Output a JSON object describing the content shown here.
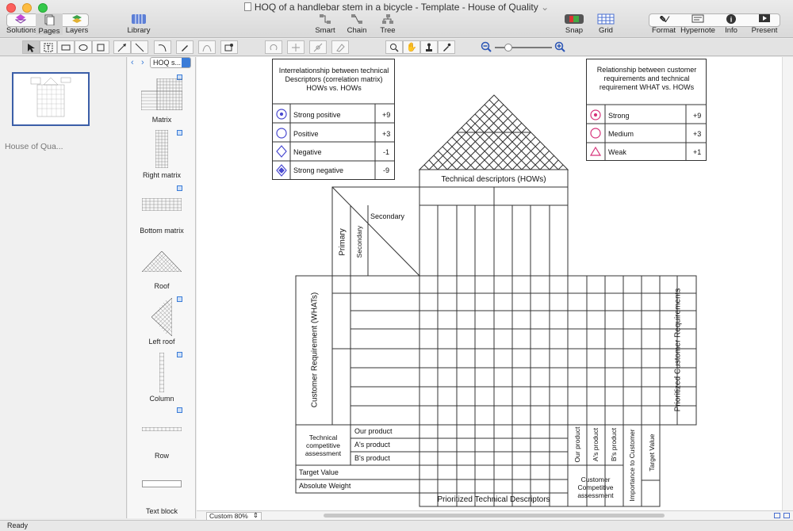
{
  "window": {
    "title": "HOQ of a handlebar stem in a bicycle - Template - House of Quality"
  },
  "toolbar": {
    "solutions": "Solutions",
    "pages": "Pages",
    "layers": "Layers",
    "library": "Library",
    "smart": "Smart",
    "chain": "Chain",
    "tree": "Tree",
    "snap": "Snap",
    "grid": "Grid",
    "format": "Format",
    "hypernote": "Hypernote",
    "info": "Info",
    "present": "Present"
  },
  "pages_panel": {
    "thumb_label": "House of Qua..."
  },
  "library": {
    "selector": "HOQ s...",
    "items": [
      "Matrix",
      "Right matrix",
      "Bottom matrix",
      "Roof",
      "Left roof",
      "Column",
      "Row",
      "Text block"
    ]
  },
  "legend_left": {
    "title": "Interrelationship between technical Descriptors (correlation matrix) HOWs vs. HOWs",
    "rows": [
      {
        "label": "Strong positive",
        "value": "+9"
      },
      {
        "label": "Positive",
        "value": "+3"
      },
      {
        "label": "Negative",
        "value": "-1"
      },
      {
        "label": "Strong negative",
        "value": "-9"
      }
    ]
  },
  "legend_right": {
    "title": "Relationship between customer requirements and technical requirement WHAT vs. HOWs",
    "rows": [
      {
        "label": "Strong",
        "value": "+9"
      },
      {
        "label": "Medium",
        "value": "+3"
      },
      {
        "label": "Weak",
        "value": "+1"
      }
    ]
  },
  "hoq": {
    "technical_descriptors": "Technical descriptors (HOWs)",
    "secondary_h": "Secondary",
    "primary": "Primary",
    "secondary_v": "Secondary",
    "customer_requirement": "Customer Requirement (WHATs)",
    "prioritized_customer": "Prioritized Customer Requirements",
    "tech_assessment": "Technical competitive assessment",
    "our_product": "Our product",
    "a_product": "A's product",
    "b_product": "B's product",
    "target_value": "Target Value",
    "absolute_weight": "Absolute Weight",
    "prioritized_tech": "Prioritized Technical Descriptors",
    "col_our_product": "Our product",
    "col_a_product": "A's product",
    "col_b_product": "B's product",
    "col_importance": "Importance to Customer",
    "col_target": "Target Value",
    "customer_competitive": "Customer Competitive assessment"
  },
  "bottom": {
    "zoom": "Custom 80%"
  },
  "status": {
    "text": "Ready"
  },
  "colors": {
    "accent": "#3a7cd8",
    "legend_blue": "#4a4ad0",
    "legend_pink": "#d6337a"
  }
}
